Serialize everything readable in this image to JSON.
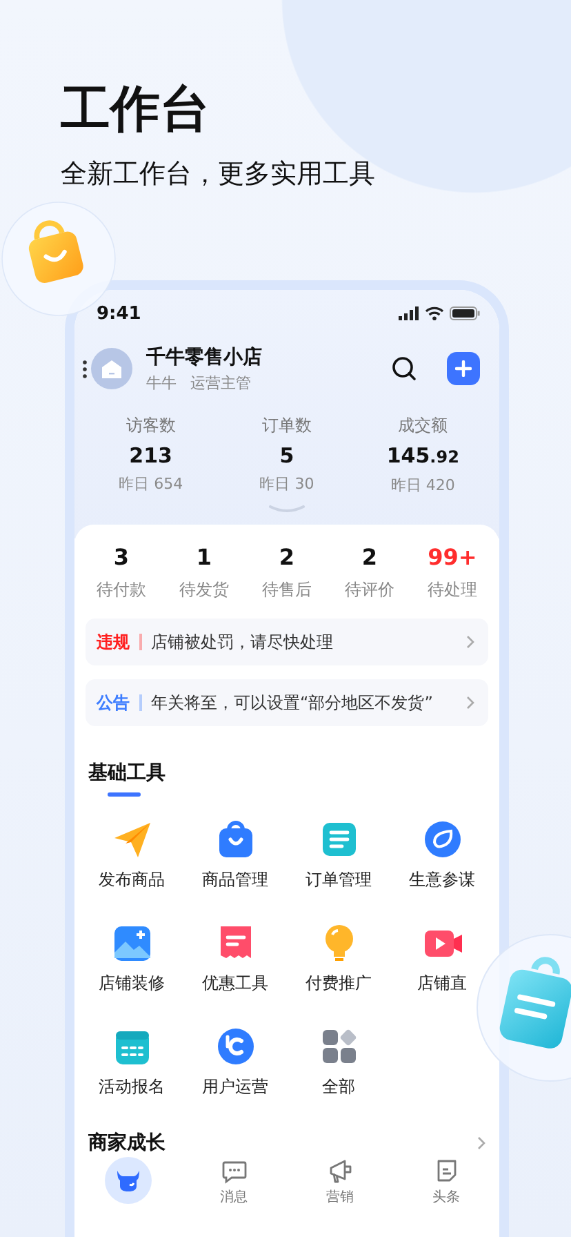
{
  "promo": {
    "title": "工作台",
    "subtitle": "全新工作台，更多实用工具"
  },
  "status_bar": {
    "time": "9:41"
  },
  "store": {
    "name": "千牛零售小店",
    "user": "牛牛",
    "role": "运营主管"
  },
  "stats": [
    {
      "label": "访客数",
      "value": "213",
      "previous": "昨日 654"
    },
    {
      "label": "订单数",
      "value": "5",
      "previous": "昨日 30"
    },
    {
      "label": "成交额",
      "value": "145.92",
      "previous": "昨日 420"
    }
  ],
  "orders": [
    {
      "count": "3",
      "label": "待付款",
      "alert": false
    },
    {
      "count": "1",
      "label": "待发货",
      "alert": false
    },
    {
      "count": "2",
      "label": "待售后",
      "alert": false
    },
    {
      "count": "2",
      "label": "待评价",
      "alert": false
    },
    {
      "count": "99+",
      "label": "待处理",
      "alert": true
    }
  ],
  "notices": [
    {
      "tag": "违规",
      "text": "店铺被处罚，请尽快处理",
      "color": "#ff1f1f"
    },
    {
      "tag": "公告",
      "text": "年关将至，可以设置“部分地区不发货”",
      "color": "#3d7dff"
    }
  ],
  "tools_section": {
    "title": "基础工具",
    "items": [
      {
        "label": "发布商品",
        "kind": "plane"
      },
      {
        "label": "商品管理",
        "kind": "bag"
      },
      {
        "label": "订单管理",
        "kind": "doc"
      },
      {
        "label": "生意参谋",
        "kind": "compass"
      },
      {
        "label": "店铺装修",
        "kind": "image"
      },
      {
        "label": "优惠工具",
        "kind": "ticket"
      },
      {
        "label": "付费推广",
        "kind": "bulb"
      },
      {
        "label": "店铺直",
        "kind": "video"
      },
      {
        "label": "活动报名",
        "kind": "calendar"
      },
      {
        "label": "用户运营",
        "kind": "logo"
      },
      {
        "label": "全部",
        "kind": "grid"
      }
    ]
  },
  "growth_section": {
    "title": "商家成长"
  },
  "tab_bar": [
    {
      "kind": "bull",
      "selected": true
    },
    {
      "kind": "chat",
      "label": "消息",
      "selected": false
    },
    {
      "kind": "megaphone",
      "label": "营销",
      "selected": false
    },
    {
      "kind": "doc",
      "label": "头条",
      "selected": false
    }
  ]
}
